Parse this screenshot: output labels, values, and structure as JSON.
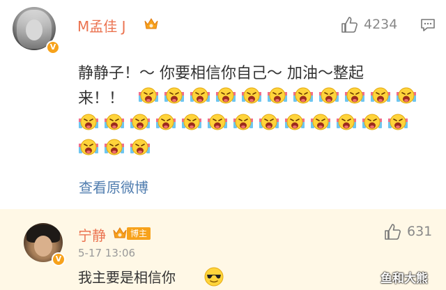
{
  "comment": {
    "username": "M孟佳 J",
    "likes": "4234",
    "text_line1": "静静子！～ 你要相信你自己～ 加油～整起",
    "text_line2": "来！！",
    "emoji_name": "shouting-emoji",
    "emoji_count": 27,
    "view_original": "查看原微博"
  },
  "reply": {
    "username": "宁静",
    "host_tag": "博主",
    "likes": "631",
    "timestamp": "5-17 13:06",
    "text": "我主要是相信你",
    "emoji_name": "sunglasses-emoji"
  },
  "badge": {
    "verified": "V"
  },
  "watermark": "鱼和大熊",
  "colors": {
    "username": "#eb7350",
    "link": "#507daf",
    "badge": "#f7a21b",
    "reply_bg": "#fff8e6"
  }
}
